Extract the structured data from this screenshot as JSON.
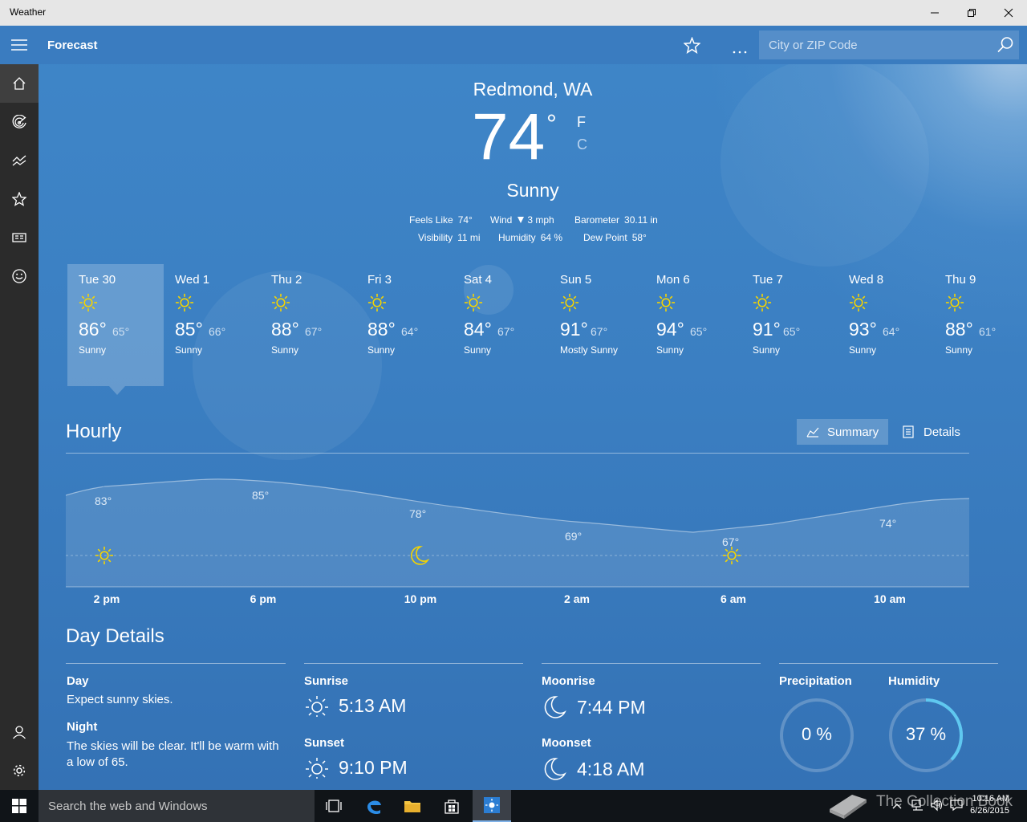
{
  "window": {
    "title": "Weather"
  },
  "header": {
    "title": "Forecast",
    "search_placeholder": "City or ZIP Code"
  },
  "current": {
    "location": "Redmond, WA",
    "temperature": "74",
    "degree": "°",
    "unit_f": "F",
    "unit_c": "C",
    "condition": "Sunny",
    "feels_like_label": "Feels Like",
    "feels_like": "74°",
    "wind_label": "Wind",
    "wind": "3 mph",
    "barometer_label": "Barometer",
    "barometer": "30.11 in",
    "visibility_label": "Visibility",
    "visibility": "11 mi",
    "humidity_label": "Humidity",
    "humidity": "64 %",
    "dew_point_label": "Dew Point",
    "dew_point": "58°"
  },
  "daily": [
    {
      "day": "Tue 30",
      "high": "86°",
      "low": "65°",
      "condition": "Sunny"
    },
    {
      "day": "Wed 1",
      "high": "85°",
      "low": "66°",
      "condition": "Sunny"
    },
    {
      "day": "Thu 2",
      "high": "88°",
      "low": "67°",
      "condition": "Sunny"
    },
    {
      "day": "Fri 3",
      "high": "88°",
      "low": "64°",
      "condition": "Sunny"
    },
    {
      "day": "Sat 4",
      "high": "84°",
      "low": "67°",
      "condition": "Sunny"
    },
    {
      "day": "Sun 5",
      "high": "91°",
      "low": "67°",
      "condition": "Mostly Sunny"
    },
    {
      "day": "Mon 6",
      "high": "94°",
      "low": "65°",
      "condition": "Sunny"
    },
    {
      "day": "Tue 7",
      "high": "91°",
      "low": "65°",
      "condition": "Sunny"
    },
    {
      "day": "Wed 8",
      "high": "93°",
      "low": "64°",
      "condition": "Sunny"
    },
    {
      "day": "Thu 9",
      "high": "88°",
      "low": "61°",
      "condition": "Sunny"
    }
  ],
  "hourly": {
    "title": "Hourly",
    "summary_label": "Summary",
    "details_label": "Details",
    "points": [
      {
        "time": "2 pm",
        "temp": "83°",
        "icon": "sun-icon"
      },
      {
        "time": "6 pm",
        "temp": "85°",
        "icon": ""
      },
      {
        "time": "10 pm",
        "temp": "78°",
        "icon": "moon-icon"
      },
      {
        "time": "2 am",
        "temp": "69°",
        "icon": ""
      },
      {
        "time": "6 am",
        "temp": "67°",
        "icon": "sun-icon"
      },
      {
        "time": "10 am",
        "temp": "74°",
        "icon": ""
      }
    ]
  },
  "day_details": {
    "title": "Day Details",
    "day_label": "Day",
    "day_text": "Expect sunny skies.",
    "night_label": "Night",
    "night_text": "The skies will be clear. It'll be warm with a low of 65.",
    "sunrise_label": "Sunrise",
    "sunrise": "5:13 AM",
    "sunset_label": "Sunset",
    "sunset": "9:10 PM",
    "moonrise_label": "Moonrise",
    "moonrise": "7:44 PM",
    "moonset_label": "Moonset",
    "moonset": "4:18 AM",
    "precipitation_label": "Precipitation",
    "precipitation": "0 %",
    "precipitation_fraction": 0,
    "humidity_label": "Humidity",
    "humidity": "37 %",
    "humidity_fraction": 0.37,
    "ring_color": "#5fc8f0"
  },
  "taskbar": {
    "search_placeholder": "Search the web and Windows",
    "time": "10:16 AM",
    "date": "6/26/2015",
    "watermark": "The Collection Book"
  }
}
